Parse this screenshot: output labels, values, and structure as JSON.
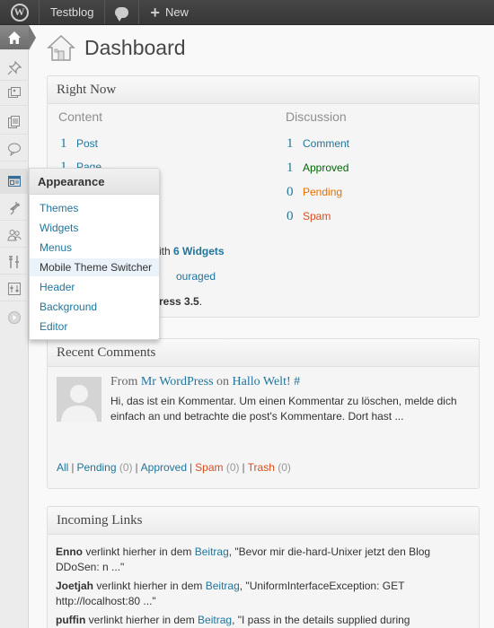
{
  "adminbar": {
    "site_name": "Testblog",
    "new_label": "New"
  },
  "page": {
    "title": "Dashboard"
  },
  "right_now": {
    "title": "Right Now",
    "content_heading": "Content",
    "discussion_heading": "Discussion",
    "content_rows": [
      {
        "count": "1",
        "label": "Post"
      },
      {
        "count": "1",
        "label": "Page"
      }
    ],
    "discussion_rows": [
      {
        "count": "1",
        "label": "Comment"
      },
      {
        "count": "1",
        "label": "Approved"
      },
      {
        "count": "0",
        "label": "Pending"
      },
      {
        "count": "0",
        "label": "Spam"
      }
    ],
    "theme_line_tail": "ith",
    "widgets_link": "6 Widgets",
    "search_line_tail": "ouraged",
    "version_line_tail": "ress 3.5",
    "version_suffix": "."
  },
  "recent_comments": {
    "title": "Recent Comments",
    "from": "From",
    "author": "Mr WordPress",
    "on": "on",
    "post_link": "Hallo Welt! #",
    "text": "Hi, das ist ein Kommentar. Um einen Kommentar zu löschen, melde dich einfach an und betrachte die post's Kommentare. Dort hast ...",
    "filters": {
      "all": "All",
      "pending": "Pending",
      "pending_count": "(0)",
      "approved": "Approved",
      "spam": "Spam",
      "spam_count": "(0)",
      "trash": "Trash",
      "trash_count": "(0)",
      "separator": "|"
    }
  },
  "incoming_links": {
    "title": "Incoming Links",
    "items": [
      {
        "author": "Enno",
        "mid": " verlinkt hierher in dem ",
        "link": "Beitrag",
        "quote": ", \"Bevor mir die-hard-Unixer jetzt den Blog DDoSen: n ...\""
      },
      {
        "author": "Joetjah",
        "mid": " verlinkt hierher in dem ",
        "link": "Beitrag",
        "quote": ", \"UniformInterfaceException: GET http://localhost:80 ...\""
      },
      {
        "author": "puffin",
        "mid": " verlinkt hierher in dem ",
        "link": "Beitrag",
        "quote": ", \"I pass in the details supplied during"
      }
    ]
  },
  "appearance_menu": {
    "title": "Appearance",
    "items": [
      "Themes",
      "Widgets",
      "Menus",
      "Mobile Theme Switcher",
      "Header",
      "Background",
      "Editor"
    ],
    "highlighted": "Mobile Theme Switcher"
  },
  "sidebar_icons": [
    "dashboard-icon",
    "posts-icon",
    "media-icon",
    "pages-icon",
    "comments-icon",
    "appearance-icon",
    "plugins-icon",
    "users-icon",
    "tools-icon",
    "settings-icon",
    "collapse-icon"
  ]
}
